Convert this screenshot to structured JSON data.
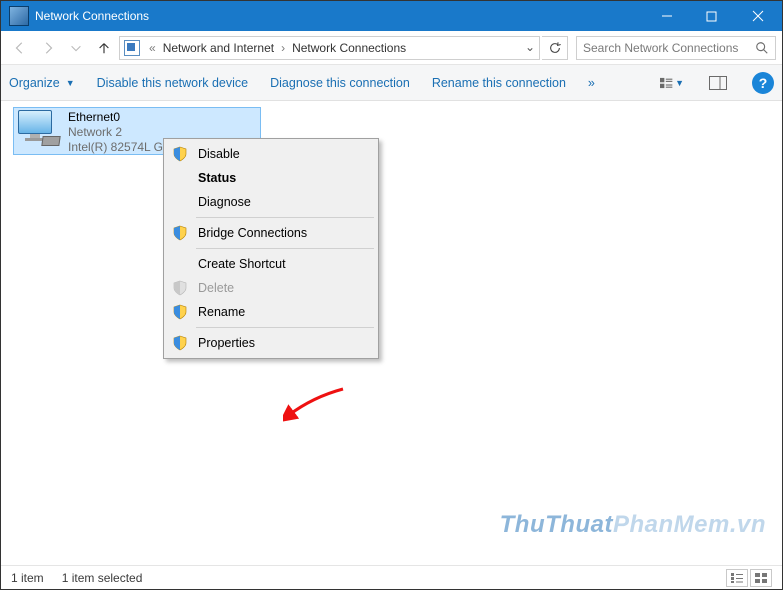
{
  "titlebar": {
    "title": "Network Connections"
  },
  "breadcrumb": {
    "items": [
      "Network and Internet",
      "Network Connections"
    ]
  },
  "search": {
    "placeholder": "Search Network Connections"
  },
  "toolbar": {
    "organize": "Organize",
    "disable": "Disable this network device",
    "diagnose": "Diagnose this connection",
    "rename": "Rename this connection",
    "more_chevron": "»"
  },
  "adapter": {
    "name": "Ethernet0",
    "network": "Network 2",
    "device": "Intel(R) 82574L Gig..."
  },
  "context_menu": {
    "disable": "Disable",
    "status": "Status",
    "diagnose": "Diagnose",
    "bridge": "Bridge Connections",
    "shortcut": "Create Shortcut",
    "delete": "Delete",
    "rename": "Rename",
    "properties": "Properties"
  },
  "statusbar": {
    "count": "1 item",
    "selection": "1 item selected"
  },
  "watermark": {
    "a": "ThuThuat",
    "b": "PhanMem",
    "c": ".vn"
  }
}
